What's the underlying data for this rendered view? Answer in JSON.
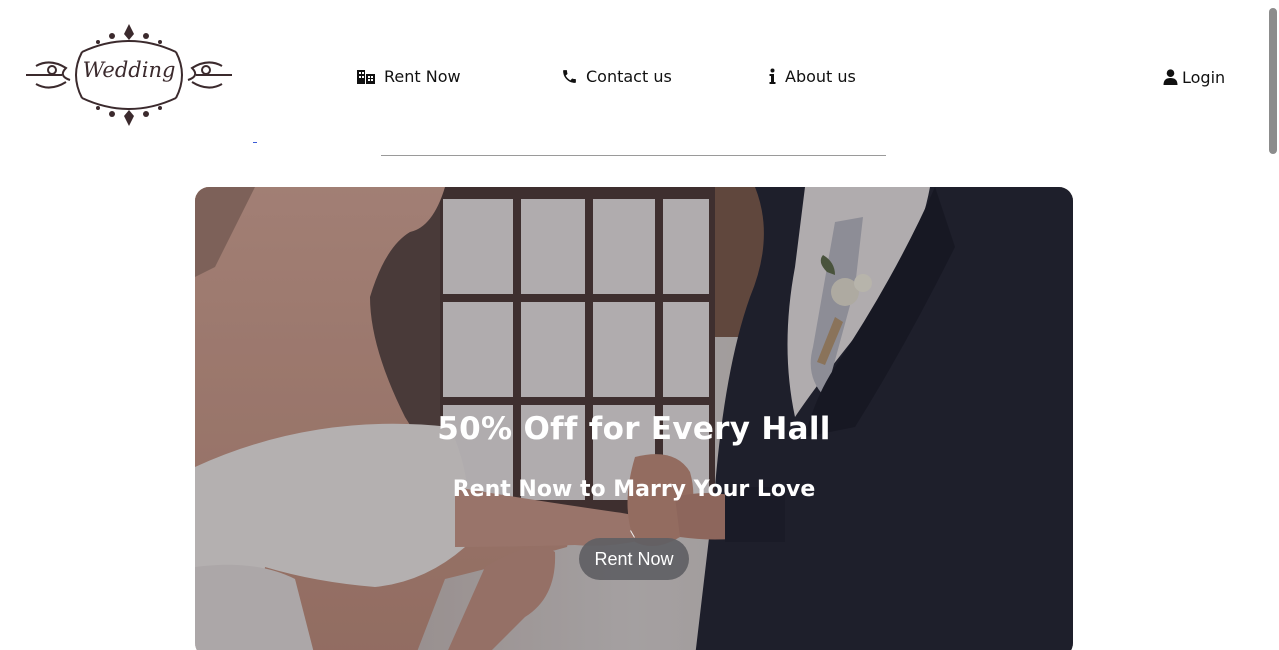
{
  "logo": {
    "text": "Wedding"
  },
  "nav": {
    "items": [
      {
        "label": "Rent Now",
        "icon": "building-icon"
      },
      {
        "label": "Contact us",
        "icon": "phone-icon"
      },
      {
        "label": "About us",
        "icon": "info-icon"
      }
    ],
    "login": {
      "label": "Login",
      "icon": "user-icon"
    }
  },
  "hero": {
    "title": "50% Off for Every Hall",
    "subtitle": "Rent Now to Marry Your Love",
    "button_label": "Rent Now"
  },
  "colors": {
    "text": "#111111",
    "logo": "#3b2a2d",
    "button_bg": "#5f5f64",
    "divider": "#9a9a9a"
  }
}
